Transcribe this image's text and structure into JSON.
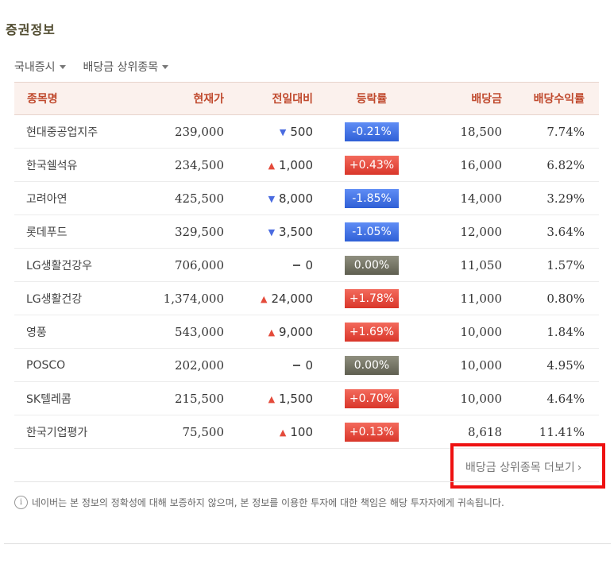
{
  "section_title": "증권정보",
  "tabs": [
    {
      "label": "국내증시"
    },
    {
      "label": "배당금 상위종목"
    }
  ],
  "table": {
    "headers": {
      "name": "종목명",
      "price": "현재가",
      "change": "전일대비",
      "rate": "등락률",
      "dividend": "배당금",
      "yield": "배당수익률"
    },
    "rows": [
      {
        "name": "현대중공업지주",
        "price": "239,000",
        "direction": "down",
        "change": "500",
        "rate": "-0.21%",
        "dividend": "18,500",
        "yield": "7.74%"
      },
      {
        "name": "한국쉘석유",
        "price": "234,500",
        "direction": "up",
        "change": "1,000",
        "rate": "+0.43%",
        "dividend": "16,000",
        "yield": "6.82%"
      },
      {
        "name": "고려아연",
        "price": "425,500",
        "direction": "down",
        "change": "8,000",
        "rate": "-1.85%",
        "dividend": "14,000",
        "yield": "3.29%"
      },
      {
        "name": "롯데푸드",
        "price": "329,500",
        "direction": "down",
        "change": "3,500",
        "rate": "-1.05%",
        "dividend": "12,000",
        "yield": "3.64%"
      },
      {
        "name": "LG생활건강우",
        "price": "706,000",
        "direction": "flat",
        "change": "0",
        "rate": "0.00%",
        "dividend": "11,050",
        "yield": "1.57%"
      },
      {
        "name": "LG생활건강",
        "price": "1,374,000",
        "direction": "up",
        "change": "24,000",
        "rate": "+1.78%",
        "dividend": "11,000",
        "yield": "0.80%"
      },
      {
        "name": "영풍",
        "price": "543,000",
        "direction": "up",
        "change": "9,000",
        "rate": "+1.69%",
        "dividend": "10,000",
        "yield": "1.84%"
      },
      {
        "name": "POSCO",
        "price": "202,000",
        "direction": "flat",
        "change": "0",
        "rate": "0.00%",
        "dividend": "10,000",
        "yield": "4.95%"
      },
      {
        "name": "SK텔레콤",
        "price": "215,500",
        "direction": "up",
        "change": "1,500",
        "rate": "+0.70%",
        "dividend": "10,000",
        "yield": "4.64%"
      },
      {
        "name": "한국기업평가",
        "price": "75,500",
        "direction": "up",
        "change": "100",
        "rate": "+0.13%",
        "dividend": "8,618",
        "yield": "11.41%"
      }
    ]
  },
  "more_link": "배당금 상위종목 더보기",
  "notice": "네이버는 본 정보의 정확성에 대해 보증하지 않으며, 본 정보를 이용한 투자에 대한 책임은 해당 투자자에게 귀속됩니다.",
  "colors": {
    "up": "#e44b3b",
    "down": "#4a6be0",
    "flat": "#5f5f50",
    "highlight_box": "#ee1111"
  }
}
